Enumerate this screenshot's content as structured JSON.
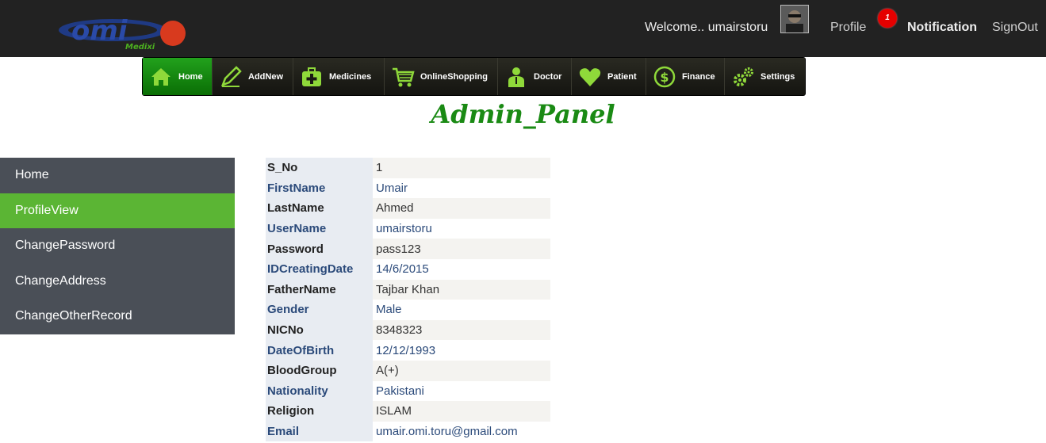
{
  "header": {
    "logo_text": "omi",
    "logo_subtext": "Medixi",
    "welcome": "Welcome.. umairstoru",
    "profile_link": "Profile",
    "notification_count": "1",
    "notification_link": "Notification",
    "signout_link": "SignOut"
  },
  "menu": [
    {
      "label": "Home",
      "icon": "house-icon",
      "active": true
    },
    {
      "label": "AddNew",
      "icon": "pencil-icon"
    },
    {
      "label": "Medicines",
      "icon": "medkit-icon"
    },
    {
      "label": "OnlineShopping",
      "icon": "cart-icon"
    },
    {
      "label": "Doctor",
      "icon": "doctor-icon"
    },
    {
      "label": "Patient",
      "icon": "heart-icon"
    },
    {
      "label": "Finance",
      "icon": "dollar-icon"
    },
    {
      "label": "Settings",
      "icon": "gears-icon"
    }
  ],
  "title": "Admin_Panel",
  "sidebar": [
    {
      "label": "Home"
    },
    {
      "label": "ProfileView",
      "active": true
    },
    {
      "label": "ChangePassword"
    },
    {
      "label": "ChangeAddress"
    },
    {
      "label": "ChangeOtherRecord"
    }
  ],
  "profile": [
    {
      "key": "S_No",
      "value": "1"
    },
    {
      "key": "FirstName",
      "value": "Umair"
    },
    {
      "key": "LastName",
      "value": "Ahmed"
    },
    {
      "key": "UserName",
      "value": "umairstoru"
    },
    {
      "key": "Password",
      "value": "pass123"
    },
    {
      "key": "IDCreatingDate",
      "value": "14/6/2015"
    },
    {
      "key": "FatherName",
      "value": "Tajbar Khan"
    },
    {
      "key": "Gender",
      "value": "Male"
    },
    {
      "key": "NICNo",
      "value": "8348323"
    },
    {
      "key": "DateOfBirth",
      "value": "12/12/1993"
    },
    {
      "key": "BloodGroup",
      "value": "A(+)"
    },
    {
      "key": "Nationality",
      "value": "Pakistani"
    },
    {
      "key": "Religion",
      "value": "ISLAM"
    },
    {
      "key": "Email",
      "value": "umair.omi.toru@gmail.com"
    }
  ],
  "colors": {
    "accent_green": "#5bb534",
    "title_green": "#1a8a14",
    "topbar": "#222222",
    "sidebar": "#4a4f57",
    "badge_red": "#e50000"
  }
}
